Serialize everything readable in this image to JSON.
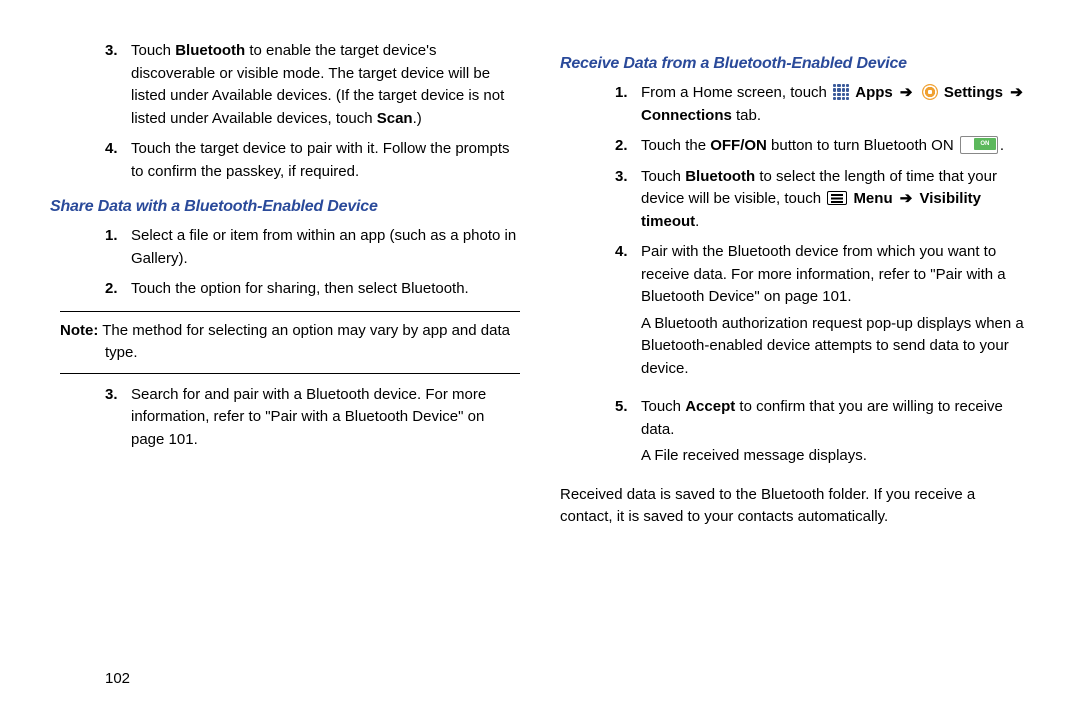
{
  "left": {
    "step3": {
      "num": "3.",
      "prefix": "Touch ",
      "bluetooth": "Bluetooth",
      "after_bluetooth": " to enable the target device's discoverable or visible mode. The target device will be listed under Available devices. (If the target device is not listed under Available devices, touch ",
      "scan": "Scan",
      "end": ".)"
    },
    "step4": {
      "num": "4.",
      "text": "Touch the target device to pair with it. Follow the prompts to confirm the passkey, if required."
    },
    "heading_share": "Share Data with a Bluetooth-Enabled Device",
    "share1": {
      "num": "1.",
      "text": "Select a file or item from within an app (such as a photo in Gallery)."
    },
    "share2": {
      "num": "2.",
      "text": "Touch the option for sharing, then select Bluetooth."
    },
    "note": {
      "label": "Note:",
      "text": " The method for selecting an option may vary by app and data type."
    },
    "share3": {
      "num": "3.",
      "prefix": "Search for and pair with a Bluetooth device. For more information, refer to ",
      "quote": "\"Pair with a Bluetooth Device\"",
      "suffix": " on page 101."
    }
  },
  "right": {
    "heading_receive": "Receive Data from a Bluetooth-Enabled Device",
    "r1": {
      "num": "1.",
      "prefix": "From a Home screen, touch ",
      "apps": "Apps",
      "arrow1": "➔",
      "settings": "Settings",
      "arrow2": "➔",
      "connections": "Connections",
      "tab": " tab."
    },
    "r2": {
      "num": "2.",
      "prefix": "Touch the ",
      "offon": "OFF/ON",
      "suffix": " button to turn Bluetooth ON ",
      "toggle_label": "ON",
      "end": "."
    },
    "r3": {
      "num": "3.",
      "prefix": "Touch ",
      "bluetooth": "Bluetooth",
      "middle": " to select the length of time that your device will be visible, touch ",
      "menu": "Menu",
      "arrow": "➔",
      "visibility": "Visibility timeout",
      "end": "."
    },
    "r4": {
      "num": "4.",
      "prefix": "Pair with the Bluetooth device from which you want to receive data. For more information, refer to ",
      "quote": "\"Pair with a Bluetooth Device\"",
      "suffix": " on page 101.",
      "auth": "A Bluetooth authorization request pop-up displays when a Bluetooth-enabled device attempts to send data to your device."
    },
    "r5": {
      "num": "5.",
      "prefix": "Touch ",
      "accept": "Accept",
      "suffix": " to confirm that you are willing to receive data.",
      "file": "A File received message displays."
    },
    "last": "Received data is saved to the Bluetooth folder. If you receive a contact, it is saved to your contacts automatically."
  },
  "page_number": "102"
}
